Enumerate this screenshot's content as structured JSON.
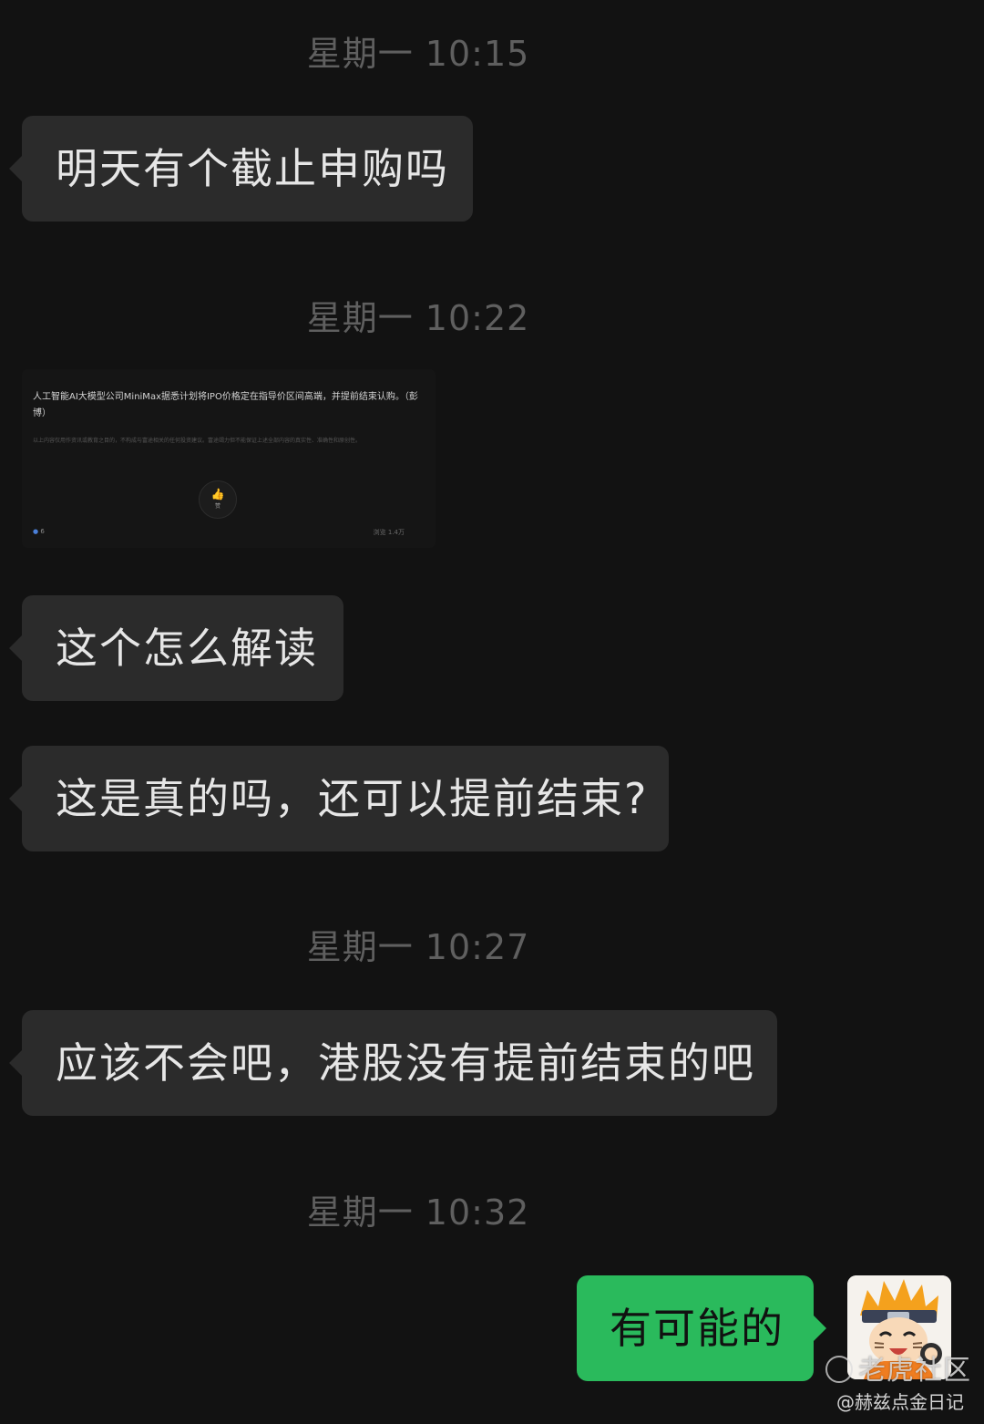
{
  "timestamps": {
    "t1": "星期一 10:15",
    "t2": "星期一 10:22",
    "t3": "星期一 10:27",
    "t4": "星期一 10:32"
  },
  "messages": {
    "m1": "明天有个截止申购吗",
    "m2": "这个怎么解读",
    "m3": "这是真的吗，还可以提前结束?",
    "m4": "应该不会吧，港股没有提前结束的吧",
    "m5": "有可能的"
  },
  "shared_card": {
    "title": "人工智能AI大模型公司MiniMax据悉计划将IPO价格定在指导价区间高端，并提前结束认购。（彭博）",
    "disclaimer": "以上内容仅用作资讯或教育之目的，不构成与富途相关的任何投资建议。富途竭力但不能保证上述全部内容的真实性、准确性和原创性。",
    "like_label": "赞",
    "like_count": "6",
    "views": "浏览 1.4万"
  },
  "watermark": {
    "brand": "老虎社区",
    "author": "@赫兹点金日记"
  },
  "colors": {
    "background": "#121212",
    "incoming_bubble": "#2b2b2b",
    "outgoing_bubble": "#2aba5c",
    "timestamp_text": "#5f5f5f"
  }
}
